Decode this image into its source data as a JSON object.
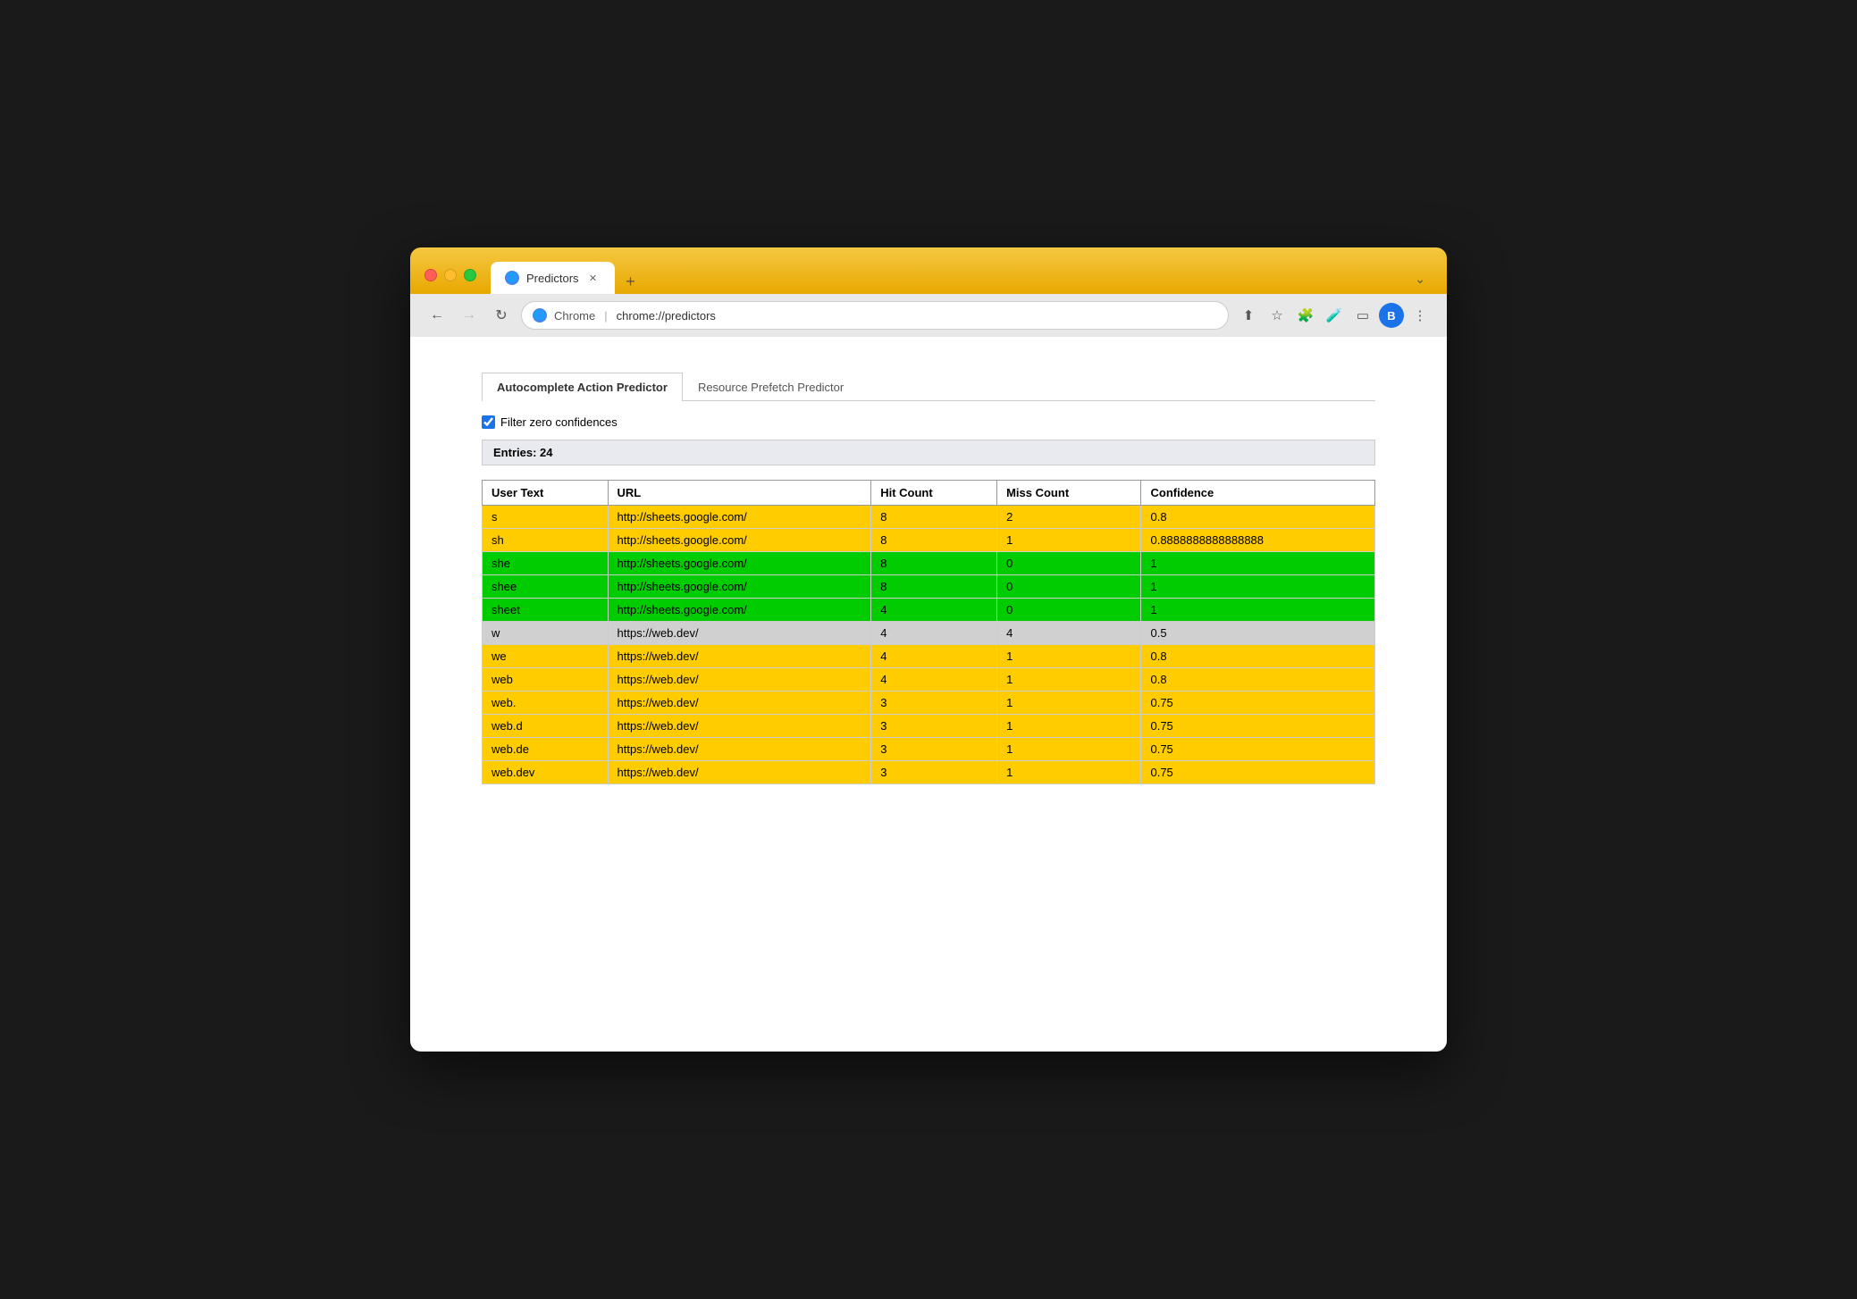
{
  "browser": {
    "tab_title": "Predictors",
    "tab_favicon": "🌐",
    "address_site": "Chrome",
    "address_url": "chrome://predictors",
    "new_tab_label": "+",
    "tab_menu_label": "⌄",
    "nav": {
      "back": "←",
      "forward": "→",
      "refresh": "↻"
    },
    "actions": {
      "share": "⬆",
      "bookmark": "☆",
      "extensions": "🧩",
      "labs": "🧪",
      "sidebar": "▭",
      "menu": "⋮"
    },
    "profile": "B"
  },
  "page": {
    "tab1": "Autocomplete Action Predictor",
    "tab2": "Resource Prefetch Predictor",
    "filter_label": "Filter zero confidences",
    "entries_label": "Entries: 24",
    "table": {
      "headers": [
        "User Text",
        "URL",
        "Hit Count",
        "Miss Count",
        "Confidence"
      ],
      "rows": [
        {
          "user_text": "s",
          "url": "http://sheets.google.com/",
          "hit": "8",
          "miss": "2",
          "confidence": "0.8",
          "color": "yellow"
        },
        {
          "user_text": "sh",
          "url": "http://sheets.google.com/",
          "hit": "8",
          "miss": "1",
          "confidence": "0.8888888888888888",
          "color": "yellow"
        },
        {
          "user_text": "she",
          "url": "http://sheets.google.com/",
          "hit": "8",
          "miss": "0",
          "confidence": "1",
          "color": "green"
        },
        {
          "user_text": "shee",
          "url": "http://sheets.google.com/",
          "hit": "8",
          "miss": "0",
          "confidence": "1",
          "color": "green"
        },
        {
          "user_text": "sheet",
          "url": "http://sheets.google.com/",
          "hit": "4",
          "miss": "0",
          "confidence": "1",
          "color": "green"
        },
        {
          "user_text": "w",
          "url": "https://web.dev/",
          "hit": "4",
          "miss": "4",
          "confidence": "0.5",
          "color": "gray"
        },
        {
          "user_text": "we",
          "url": "https://web.dev/",
          "hit": "4",
          "miss": "1",
          "confidence": "0.8",
          "color": "yellow"
        },
        {
          "user_text": "web",
          "url": "https://web.dev/",
          "hit": "4",
          "miss": "1",
          "confidence": "0.8",
          "color": "yellow"
        },
        {
          "user_text": "web.",
          "url": "https://web.dev/",
          "hit": "3",
          "miss": "1",
          "confidence": "0.75",
          "color": "yellow"
        },
        {
          "user_text": "web.d",
          "url": "https://web.dev/",
          "hit": "3",
          "miss": "1",
          "confidence": "0.75",
          "color": "yellow"
        },
        {
          "user_text": "web.de",
          "url": "https://web.dev/",
          "hit": "3",
          "miss": "1",
          "confidence": "0.75",
          "color": "yellow"
        },
        {
          "user_text": "web.dev",
          "url": "https://web.dev/",
          "hit": "3",
          "miss": "1",
          "confidence": "0.75",
          "color": "yellow"
        }
      ]
    }
  }
}
